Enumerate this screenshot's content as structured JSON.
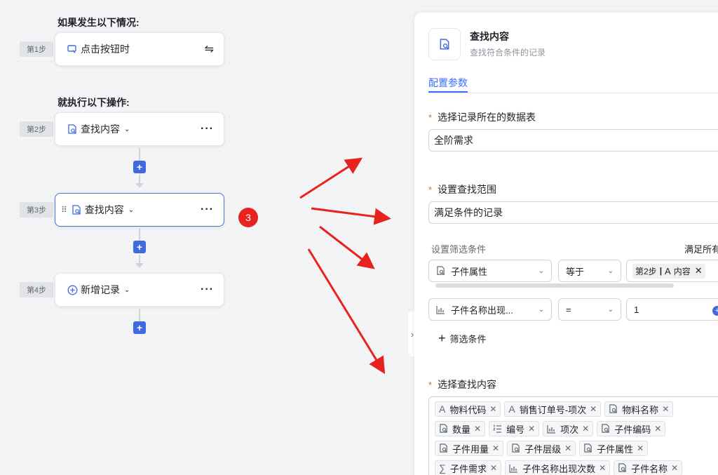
{
  "workflow": {
    "trigger_heading": "如果发生以下情况:",
    "action_heading": "就执行以下操作:",
    "steps": [
      {
        "tag": "第1步",
        "label": "点击按钮时",
        "icon": "cursor-click-icon"
      },
      {
        "tag": "第2步",
        "label": "查找内容",
        "icon": "search-doc-icon"
      },
      {
        "tag": "第3步",
        "label": "查找内容",
        "icon": "search-doc-icon"
      },
      {
        "tag": "第4步",
        "label": "新增记录",
        "icon": "plus-circle-icon"
      }
    ],
    "annotation_number": "3",
    "annotation_color": "#e8231f"
  },
  "panel": {
    "title": "查找内容",
    "subtitle": "查找符合条件的记录",
    "tab": "配置参数",
    "table_label": "选择记录所在的数据表",
    "table_value": "全阶需求",
    "range_label": "设置查找范围",
    "range_value": "满足条件的记录",
    "filter_label": "设置筛选条件",
    "filter_right": "满足所有",
    "conditions": [
      {
        "field": "子件属性",
        "field_icon": "search-doc-icon",
        "op": "等于",
        "value_step": "第2步",
        "value_sep": "|",
        "value_field": "内容",
        "value_field_icon": "text-a-icon"
      },
      {
        "field": "子件名称出现...",
        "field_icon": "bar-chart-icon",
        "op": "=",
        "value": "1"
      }
    ],
    "add_condition": "筛选条件",
    "content_label": "选择查找内容",
    "content_tags": [
      [
        {
          "icon": "A",
          "label": "物料代码"
        },
        {
          "icon": "A",
          "label": "销售订单号-项次"
        },
        {
          "icon": "doc",
          "label": "物料名称"
        }
      ],
      [
        {
          "icon": "doc",
          "label": "数量"
        },
        {
          "icon": "list",
          "label": "编号"
        },
        {
          "icon": "bar",
          "label": "项次"
        },
        {
          "icon": "doc",
          "label": "子件编码"
        }
      ],
      [
        {
          "icon": "doc",
          "label": "子件用量"
        },
        {
          "icon": "doc",
          "label": "子件层级"
        },
        {
          "icon": "doc",
          "label": "子件属性"
        }
      ],
      [
        {
          "icon": "sum",
          "label": "子件需求"
        },
        {
          "icon": "bar",
          "label": "子件名称出现次数"
        },
        {
          "icon": "doc",
          "label": "子件名称"
        }
      ]
    ],
    "accent": "#3370ff"
  }
}
